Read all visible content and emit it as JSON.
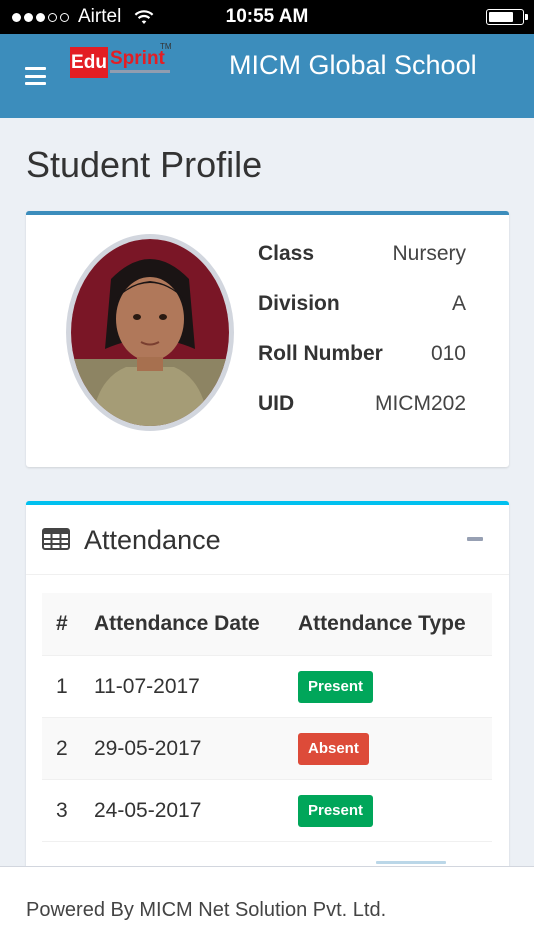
{
  "status_bar": {
    "carrier": "Airtel",
    "time": "10:55 AM",
    "signal_bars": 3,
    "signal_total": 5
  },
  "header": {
    "logo_edu": "Edu",
    "logo_sprint": "Sprint",
    "logo_tm": "TM",
    "school_name": "MICM Global School",
    "bg_color": "#3c8dbc"
  },
  "page": {
    "title": "Student Profile"
  },
  "profile": {
    "rows": [
      {
        "label": "Class",
        "value": "Nursery"
      },
      {
        "label": "Division",
        "value": "A"
      },
      {
        "label": "Roll Number",
        "value": "010"
      },
      {
        "label": "UID",
        "value": "MICM202"
      }
    ]
  },
  "attendance": {
    "title": "Attendance",
    "icon": "table-icon",
    "columns": [
      "#",
      "Attendance Date",
      "Attendance Type"
    ],
    "rows": [
      {
        "num": "1",
        "date": "11-07-2017",
        "type": "Present",
        "color": "#00a65a"
      },
      {
        "num": "2",
        "date": "29-05-2017",
        "type": "Absent",
        "color": "#dd4b39"
      },
      {
        "num": "3",
        "date": "24-05-2017",
        "type": "Present",
        "color": "#00a65a"
      }
    ]
  },
  "footer": {
    "text": "Powered By MICM Net Solution Pvt. Ltd."
  }
}
